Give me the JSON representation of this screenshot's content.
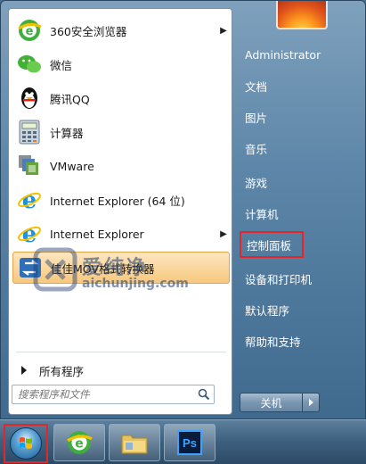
{
  "programs": [
    {
      "label": "360安全浏览器",
      "has_arrow": true,
      "icon": "360-browser-icon"
    },
    {
      "label": "微信",
      "has_arrow": false,
      "icon": "wechat-icon"
    },
    {
      "label": "腾讯QQ",
      "has_arrow": false,
      "icon": "qq-penguin-icon"
    },
    {
      "label": "计算器",
      "has_arrow": false,
      "icon": "calculator-icon"
    },
    {
      "label": "VMware",
      "has_arrow": false,
      "icon": "vmware-icon"
    },
    {
      "label": "Internet Explorer (64 位)",
      "has_arrow": false,
      "icon": "ie-icon"
    },
    {
      "label": "Internet Explorer",
      "has_arrow": true,
      "icon": "ie-icon"
    },
    {
      "label": "佳佳MOV格式转换器",
      "has_arrow": false,
      "icon": "converter-icon",
      "highlighted": true
    }
  ],
  "all_programs": "所有程序",
  "search": {
    "placeholder": "搜索程序和文件"
  },
  "right_links": [
    {
      "label": "Administrator"
    },
    {
      "label": "文档"
    },
    {
      "label": "图片"
    },
    {
      "label": "音乐"
    },
    {
      "label": "游戏"
    },
    {
      "label": "计算机"
    },
    {
      "label": "控制面板",
      "boxed": true
    },
    {
      "label": "设备和打印机"
    },
    {
      "label": "默认程序"
    },
    {
      "label": "帮助和支持"
    }
  ],
  "shutdown": {
    "label": "关机"
  },
  "taskbar": {
    "pinned": [
      "360-browser-icon",
      "file-explorer-icon",
      "photoshop-icon"
    ],
    "ps_label": "Ps"
  },
  "watermark": {
    "cn": "爱纯净",
    "en": "aichunjing.com"
  },
  "colors": {
    "highlight_box": "#e2262a",
    "hover_bg": "#f7c87e"
  }
}
